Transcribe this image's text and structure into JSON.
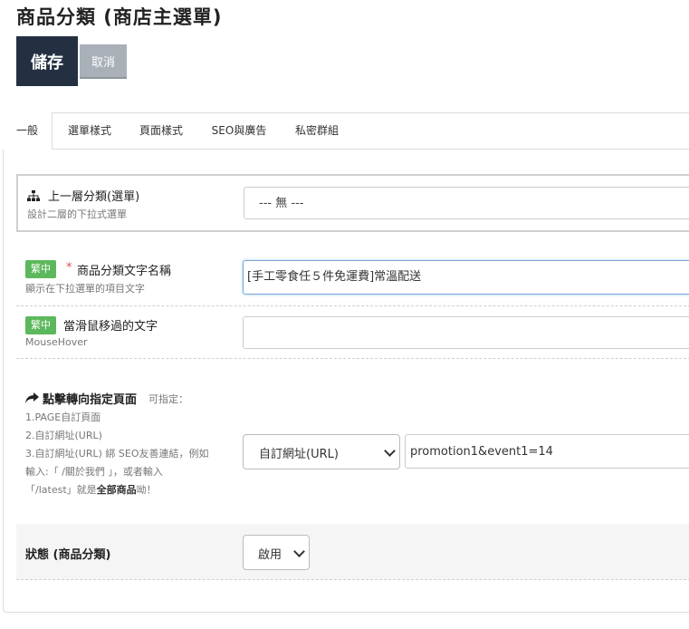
{
  "page": {
    "title": "商品分類 (商店主選單)"
  },
  "toolbar": {
    "save_label": "儲存",
    "cancel_label": "取消"
  },
  "tabs": [
    {
      "label": "一般"
    },
    {
      "label": "選單樣式"
    },
    {
      "label": "頁面樣式"
    },
    {
      "label": "SEO與廣告"
    },
    {
      "label": "私密群組"
    }
  ],
  "parent": {
    "label": "上一層分類(選單)",
    "hint": "設計二層的下拉式選單",
    "value": "--- 無 ---"
  },
  "name": {
    "badge": "繁中",
    "required": "*",
    "label": "商品分類文字名稱",
    "hint": "顯示在下拉選單的項目文字",
    "value": "[手工零食任５件免運費]常溫配送"
  },
  "hover": {
    "badge": "繁中",
    "label": "當滑鼠移過的文字",
    "hint": "MouseHover",
    "value": ""
  },
  "redirect": {
    "label": "點擊轉向指定頁面",
    "label_note": "可指定：",
    "lines": [
      "1.PAGE自訂頁面",
      "2.自訂網址(URL)",
      "3.自訂網址(URL) 綁 SEO友善連結，例如",
      "輸入:「 /關於我們 」，或者輸入"
    ],
    "last_line_prefix": "「/latest」就是",
    "last_line_bold": "全部商品",
    "last_line_suffix": "呦！",
    "type_value": "自訂網址(URL)",
    "url_value": "promotion1&event1=14"
  },
  "status": {
    "label": "狀態 (商品分類)",
    "value": "啟用"
  }
}
